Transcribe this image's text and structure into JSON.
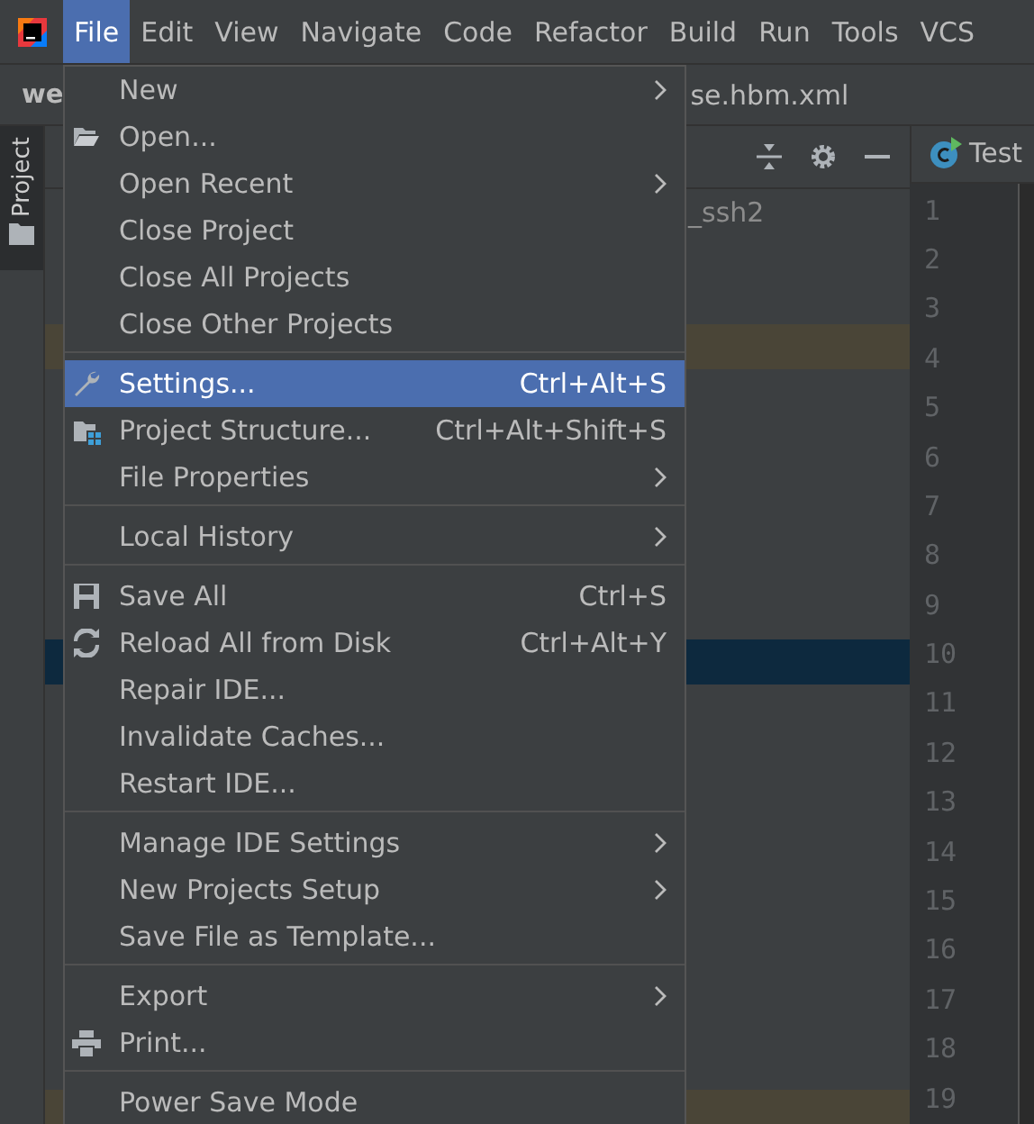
{
  "menubar": [
    {
      "label": "File",
      "selected": true
    },
    {
      "label": "Edit",
      "selected": false
    },
    {
      "label": "View",
      "selected": false
    },
    {
      "label": "Navigate",
      "selected": false
    },
    {
      "label": "Code",
      "selected": false
    },
    {
      "label": "Refactor",
      "selected": false
    },
    {
      "label": "Build",
      "selected": false
    },
    {
      "label": "Run",
      "selected": false
    },
    {
      "label": "Tools",
      "selected": false
    },
    {
      "label": "VCS",
      "selected": false
    }
  ],
  "editor_tabs": [
    {
      "label": "we"
    },
    {
      "label": "se.hbm.xml"
    }
  ],
  "sidebar_tab": {
    "label": "Project"
  },
  "project_tree": {
    "rows": [
      {
        "text": "_ssh2",
        "selected": false,
        "marked": false
      },
      {
        "selected": false,
        "marked": false
      },
      {
        "selected": false,
        "marked": false
      },
      {
        "selected": false,
        "marked": true
      },
      {
        "selected": false,
        "marked": false
      },
      {
        "selected": false,
        "marked": false
      },
      {
        "selected": false,
        "marked": false
      },
      {
        "selected": false,
        "marked": false
      },
      {
        "selected": false,
        "marked": false
      },
      {
        "selected": false,
        "marked": false
      },
      {
        "selected": true,
        "marked": false
      },
      {
        "selected": false,
        "marked": false
      },
      {
        "selected": false,
        "marked": false
      },
      {
        "selected": false,
        "marked": false
      },
      {
        "selected": false,
        "marked": false
      },
      {
        "selected": false,
        "marked": false
      },
      {
        "selected": false,
        "marked": false
      },
      {
        "selected": false,
        "marked": false
      },
      {
        "selected": false,
        "marked": false
      },
      {
        "selected": false,
        "marked": false
      },
      {
        "selected": false,
        "marked": true
      }
    ]
  },
  "editor": {
    "tab": "Test",
    "line_numbers": [
      "1",
      "2",
      "3",
      "4",
      "5",
      "6",
      "7",
      "8",
      "9",
      "10",
      "11",
      "12",
      "13",
      "14",
      "15",
      "16",
      "17",
      "18",
      "19"
    ]
  },
  "file_menu": {
    "groups": [
      [
        {
          "label": "New",
          "submenu": true,
          "selected": false
        },
        {
          "label": "Open...",
          "kind": "folder",
          "submenu": false,
          "selected": false
        },
        {
          "label": "Open Recent",
          "submenu": true,
          "selected": false
        },
        {
          "label": "Close Project",
          "submenu": false,
          "selected": false
        },
        {
          "label": "Close All Projects",
          "submenu": false,
          "selected": false
        },
        {
          "label": "Close Other Projects",
          "submenu": false,
          "selected": false
        }
      ],
      [
        {
          "label": "Settings...",
          "kind": "wrench",
          "shortcut": "Ctrl+Alt+S",
          "submenu": false,
          "selected": true
        },
        {
          "label": "Project Structure...",
          "kind": "structure",
          "shortcut": "Ctrl+Alt+Shift+S",
          "submenu": false,
          "selected": false
        },
        {
          "label": "File Properties",
          "submenu": true,
          "selected": false
        }
      ],
      [
        {
          "label": "Local History",
          "submenu": true,
          "selected": false
        }
      ],
      [
        {
          "label": "Save All",
          "kind": "save",
          "shortcut": "Ctrl+S",
          "submenu": false,
          "selected": false
        },
        {
          "label": "Reload All from Disk",
          "kind": "reload",
          "shortcut": "Ctrl+Alt+Y",
          "submenu": false,
          "selected": false
        },
        {
          "label": "Repair IDE...",
          "submenu": false,
          "selected": false
        },
        {
          "label": "Invalidate Caches...",
          "submenu": false,
          "selected": false
        },
        {
          "label": "Restart IDE...",
          "submenu": false,
          "selected": false
        }
      ],
      [
        {
          "label": "Manage IDE Settings",
          "submenu": true,
          "selected": false
        },
        {
          "label": "New Projects Setup",
          "submenu": true,
          "selected": false
        },
        {
          "label": "Save File as Template...",
          "submenu": false,
          "selected": false
        }
      ],
      [
        {
          "label": "Export",
          "submenu": true,
          "selected": false
        },
        {
          "label": "Print...",
          "kind": "print",
          "submenu": false,
          "selected": false
        }
      ],
      [
        {
          "label": "Power Save Mode",
          "submenu": false,
          "selected": false
        }
      ]
    ]
  }
}
